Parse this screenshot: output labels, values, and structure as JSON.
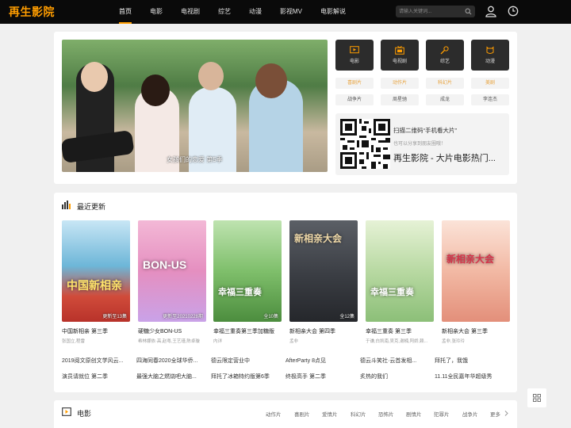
{
  "header": {
    "logo": "再生影院",
    "nav": [
      "首页",
      "电影",
      "电视剧",
      "综艺",
      "动漫",
      "影视MV",
      "电影解说"
    ],
    "search_placeholder": "请输入关键词..."
  },
  "colors": {
    "accent": "#ff9d00",
    "tag_orange": "#e8a33d",
    "topbar": "#0a0a0a"
  },
  "hero": {
    "caption": "女孩们的恋爱 第5季"
  },
  "categories": [
    {
      "label": "电影",
      "icon": "play-screen-icon"
    },
    {
      "label": "电视剧",
      "icon": "tv-icon"
    },
    {
      "label": "综艺",
      "icon": "microphone-icon"
    },
    {
      "label": "动漫",
      "icon": "cartoon-icon"
    }
  ],
  "tags": [
    [
      "喜剧片",
      "动作片",
      "科幻片",
      "美剧"
    ],
    [
      "战争片",
      "周星驰",
      "成龙",
      "李连杰"
    ]
  ],
  "qr": {
    "line1": "扫描二维码“手机看大片”",
    "line2": "也可以分享到朋友圈哦！",
    "line3": "再生影院 - 大片电影热门..."
  },
  "recent": {
    "title": "最近更新",
    "items": [
      {
        "title": "中国新相亲 第三季",
        "cast": "张国立,程雷",
        "badge": "更新至13集",
        "poster_text": "中国新相亲"
      },
      {
        "title": "硬糖少女BON-US",
        "cast": "希林娜依·高,赵粤,王艺瑾,陈卓璇",
        "badge": "更新至20210228期",
        "poster_text": "BON-US"
      },
      {
        "title": "幸福三重奏第三季加糖版",
        "cast": "内详",
        "badge": "全10集",
        "poster_text": "幸福三重奏"
      },
      {
        "title": "新相亲大会 第四季",
        "cast": "孟非",
        "badge": "全12集",
        "poster_text": "新相亲大会"
      },
      {
        "title": "幸福三重奏 第三季",
        "cast": "于谦,白凯南,吴克,谢楠,阿娇,赖...",
        "badge": "",
        "poster_text": "幸福三重奏"
      },
      {
        "title": "新相亲大会 第三季",
        "cast": "孟非,张玲玲",
        "badge": "",
        "poster_text": "新相亲大会"
      }
    ],
    "text_links": [
      [
        "2019阅文原创文学风云...",
        "四海同春2020全球华侨...",
        "德云限定营业中",
        "AfterParty 8点见",
        "德云斗笑社·云首发相...",
        "拜托了，我饿"
      ],
      [
        "演员请就位 第二季",
        "最强大脑之燃烧吧大脑...",
        "拜托了冰箱特约版第6季",
        "终极高手 第二季",
        "炙热的我们",
        "11.11全民嘉年华超级秀"
      ]
    ]
  },
  "movies": {
    "title": "电影",
    "links": [
      "动作片",
      "喜剧片",
      "爱情片",
      "科幻片",
      "恐怖片",
      "剧情片",
      "犯罪片",
      "战争片",
      "更多"
    ]
  }
}
